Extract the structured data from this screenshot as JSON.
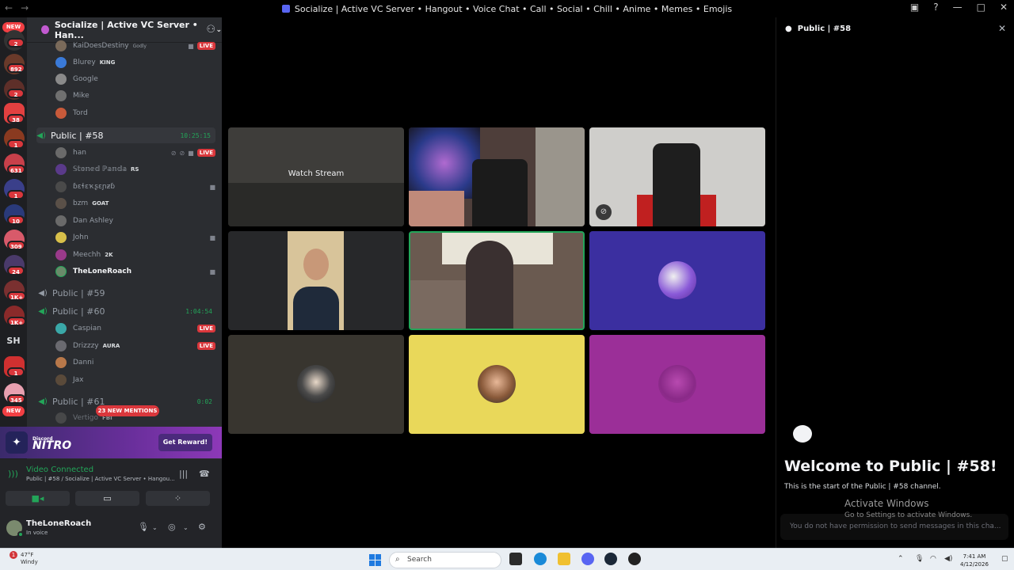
{
  "window": {
    "title": "Socialize | Active VC Server • Hangout • Voice Chat • Call • Social • Chill • Anime • Memes • Emojis",
    "back_icon": "arrow-left-icon",
    "forward_icon": "arrow-right-icon"
  },
  "server_rail": {
    "items": [
      {
        "label": "NEW",
        "kind": "new-pill"
      },
      {
        "badge": "2"
      },
      {
        "badge": "892"
      },
      {
        "badge": "2"
      },
      {
        "badge": "38"
      },
      {
        "badge": "1"
      },
      {
        "badge": "631"
      },
      {
        "badge": "1"
      },
      {
        "badge": "10"
      },
      {
        "badge": "309"
      },
      {
        "badge": "24"
      },
      {
        "badge": "1K+"
      },
      {
        "badge": "1K+"
      },
      {
        "label": "SH"
      },
      {
        "badge": "1"
      },
      {
        "badge": "345"
      },
      {
        "label": "NEW",
        "kind": "new-pill"
      }
    ]
  },
  "server": {
    "name": "Socialize | Active VC Server • Han...",
    "dropdown_icon": "chevron-down-icon",
    "invite_icon": "add-member-icon"
  },
  "channels": {
    "top_users": [
      {
        "name": "KaiDoesDestiny",
        "tag": "Godly",
        "live": "LIVE"
      },
      {
        "name": "Blurey",
        "tag": "KING"
      },
      {
        "name": "Google"
      },
      {
        "name": "Mike"
      },
      {
        "name": "Tord"
      }
    ],
    "public58": {
      "name": "Public | #58",
      "timer": "10:25:15",
      "users": [
        {
          "name": "han",
          "live": "LIVE"
        },
        {
          "name": "𝕊𝕥𝕠𝕟𝕖𝕕 ℙ𝕒𝕟𝕕𝕒",
          "tag": "RS"
        },
        {
          "name": "ɓɛɬɛҡʂɛɲƶɓ"
        },
        {
          "name": "bzm",
          "tag": "GOAT"
        },
        {
          "name": "Dan Ashley"
        },
        {
          "name": "John"
        },
        {
          "name": "Meechh",
          "tag": "2K"
        },
        {
          "name": "TheLoneRoach"
        }
      ]
    },
    "public59": {
      "name": "Public | #59"
    },
    "public60": {
      "name": "Public | #60",
      "timer": "1:04:54",
      "users": [
        {
          "name": "Caspian",
          "live": "LIVE"
        },
        {
          "name": "Drizzzy",
          "tag": "AURA",
          "live": "LIVE"
        },
        {
          "name": "Danni"
        },
        {
          "name": "Jax"
        }
      ]
    },
    "public61": {
      "name": "Public | #61",
      "timer": "0:02",
      "users": [
        {
          "name": "Vertigo",
          "tag": "FBI"
        }
      ]
    },
    "mentions": "23 NEW MENTIONS"
  },
  "nitro": {
    "small": "Discord",
    "big": "NITRO",
    "button": "Get Reward!"
  },
  "voice": {
    "status": "Video Connected",
    "sub": "Public | #58 / Socialize | Active VC Server • Hangou...",
    "controls": [
      "camera-icon",
      "screen-share-icon",
      "activities-icon"
    ]
  },
  "user": {
    "name": "TheLoneRoach",
    "status": "In voice"
  },
  "video": {
    "tiles": [
      {
        "kind": "stream",
        "label": "Watch Stream",
        "bg": "#3a3a38"
      },
      {
        "kind": "camera",
        "bg": "#5a4a45"
      },
      {
        "kind": "camera",
        "bg": "#c8c7c3",
        "mic_off": true
      },
      {
        "kind": "camera-narrow",
        "bg": "#27282a"
      },
      {
        "kind": "camera",
        "bg": "#6a5a50",
        "speaking": true
      },
      {
        "kind": "avatar",
        "bg": "#3b2fa0"
      },
      {
        "kind": "avatar",
        "bg": "#38352f"
      },
      {
        "kind": "avatar",
        "bg": "#e9d85a"
      },
      {
        "kind": "avatar",
        "bg": "#9b2f98"
      }
    ]
  },
  "chat": {
    "title": "Public | #58",
    "welcome": "Welcome to Public | #58!",
    "start": "This is the start of the Public | #58 channel.",
    "activate_title": "Activate Windows",
    "activate_sub": "Go to Settings to activate Windows.",
    "no_permission": "You do not have permission to send messages in this cha..."
  },
  "taskbar": {
    "weather_temp": "47°F",
    "weather_desc": "Windy",
    "weather_badge": "1",
    "search": "Search",
    "time": "7:41 AM",
    "date": "4/12/2026"
  },
  "colors": {
    "accent_green": "#23a559",
    "live_red": "#da373c",
    "discord_blurple": "#5865f2"
  }
}
